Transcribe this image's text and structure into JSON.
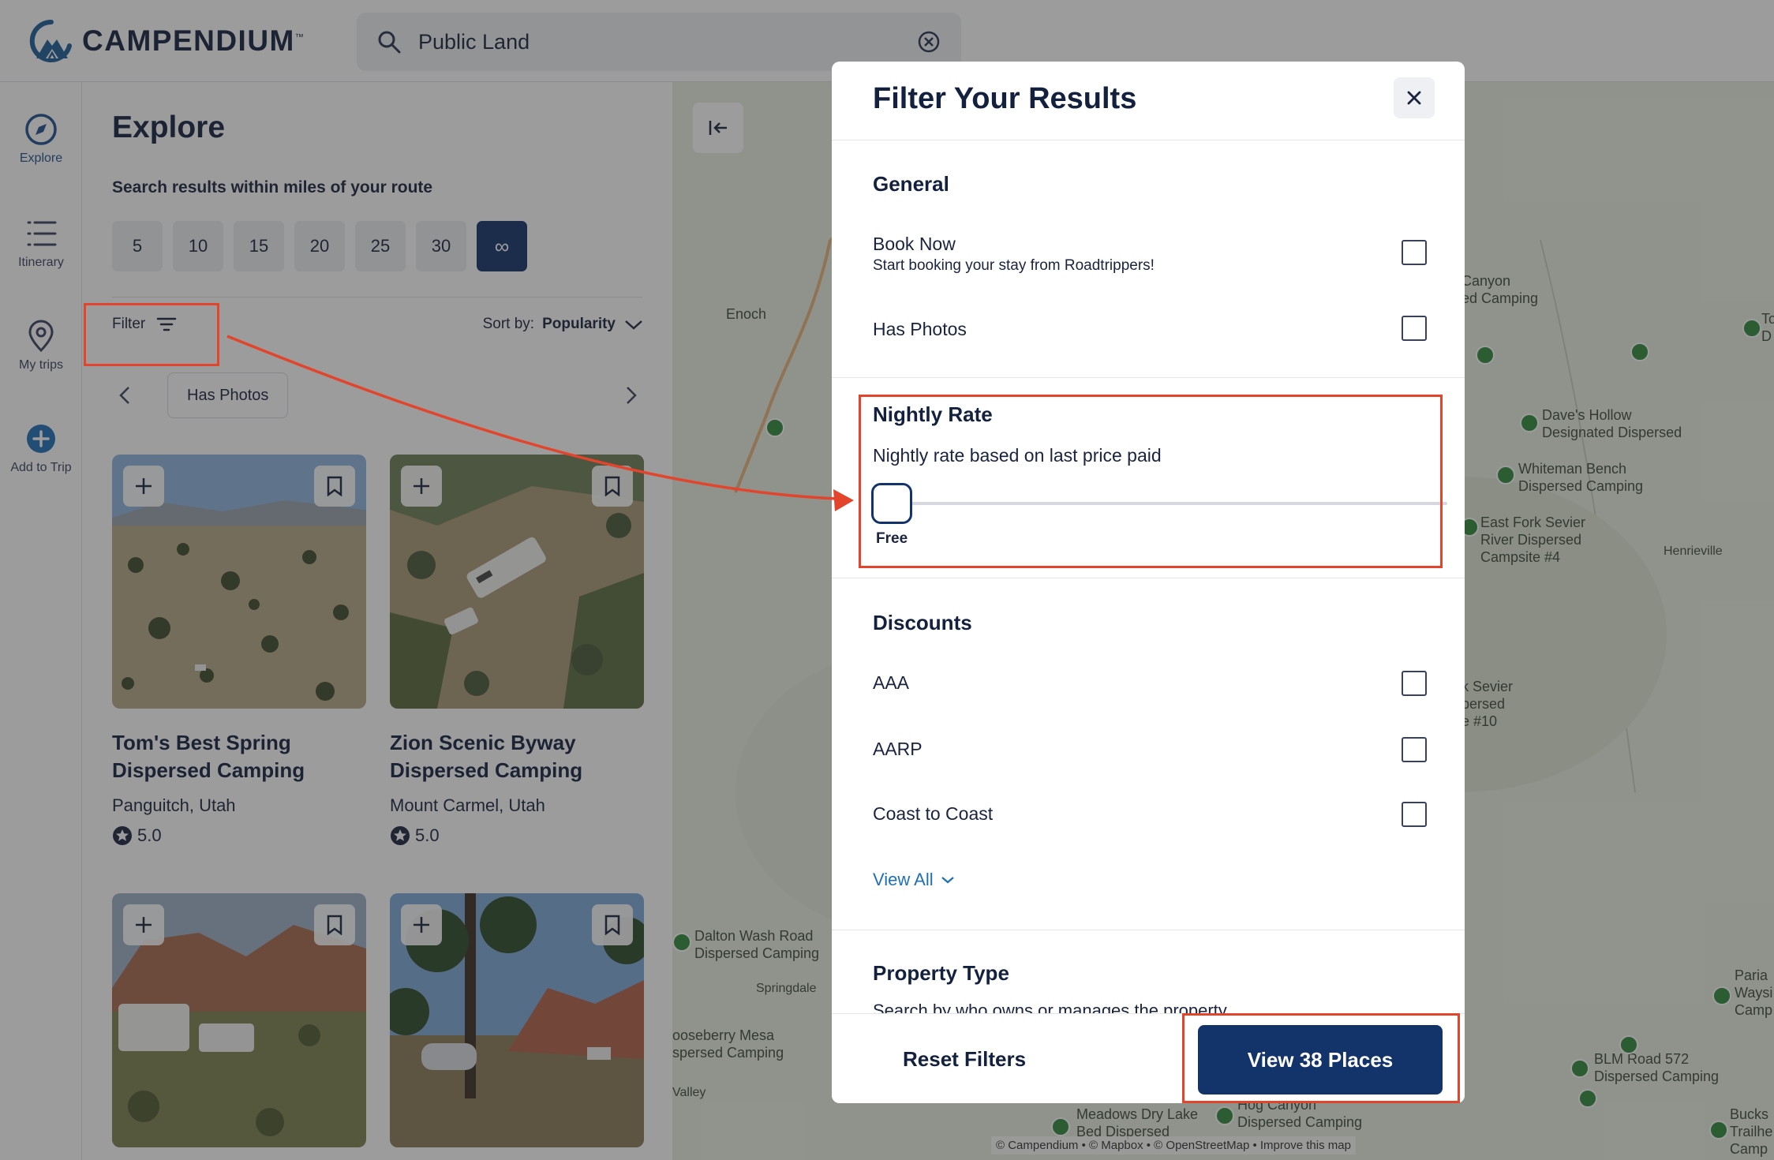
{
  "header": {
    "brand": "CAMPENDIUM",
    "brand_tm": "™",
    "search_value": "Public Land"
  },
  "nav": {
    "items": [
      {
        "label": "Explore",
        "icon": "compass-icon"
      },
      {
        "label": "Itinerary",
        "icon": "list-icon"
      },
      {
        "label": "My trips",
        "icon": "map-pin-icon"
      },
      {
        "label": "Add to Trip",
        "icon": "plus-circle-icon"
      }
    ]
  },
  "panel": {
    "title": "Explore",
    "subtitle": "Search results within miles of your route",
    "miles": [
      "5",
      "10",
      "15",
      "20",
      "25",
      "30",
      "∞"
    ],
    "selected_mile": "∞",
    "filter_label": "Filter",
    "sort_prefix": "Sort by:",
    "sort_value": "Popularity",
    "chips": [
      "Has Photos"
    ],
    "cards": [
      {
        "name": "Tom's Best Spring Dispersed Camping",
        "location": "Panguitch, Utah",
        "rating": "5.0"
      },
      {
        "name": "Zion Scenic Byway Dispersed Camping",
        "location": "Mount Carmel, Utah",
        "rating": "5.0"
      },
      {
        "name": "",
        "location": "",
        "rating": ""
      },
      {
        "name": "",
        "location": "",
        "rating": ""
      }
    ]
  },
  "map": {
    "labels": [
      "Enoch",
      "Canyon",
      "ed Camping",
      "Dave's Hollow",
      "Designated Dispersed",
      "Whiteman Bench",
      "Dispersed Camping",
      "East Fork Sevier",
      "River Dispersed",
      "Campsite #4",
      "Henrieville",
      "k Sevier",
      "persed",
      "e #10",
      "Dalton Wash Road",
      "Dispersed Camping",
      "Springdale",
      "ooseberry Mesa",
      "spersed Camping",
      "Valley",
      "Meadows Dry Lake",
      "Bed Dispersed",
      "Hog Canyon",
      "Dispersed Camping",
      "BLM Road 572",
      "Dispersed Camping",
      "Paria",
      "Waysi",
      "Camp",
      "Bucks",
      "Trailhe",
      "Camp",
      "To",
      "D"
    ],
    "attribution": "© Campendium • © Mapbox • © OpenStreetMap • Improve this map"
  },
  "modal": {
    "title": "Filter Your Results",
    "general": {
      "title": "General",
      "options": [
        {
          "label": "Book Now",
          "sub": "Start booking your stay from Roadtrippers!",
          "checked": false
        },
        {
          "label": "Has Photos",
          "sub": "",
          "checked": false
        }
      ]
    },
    "nightly": {
      "title": "Nightly Rate",
      "desc": "Nightly rate based on last price paid",
      "value_label": "Free",
      "value_fraction": 0
    },
    "discounts": {
      "title": "Discounts",
      "options": [
        {
          "label": "AAA",
          "checked": false
        },
        {
          "label": "AARP",
          "checked": false
        },
        {
          "label": "Coast to Coast",
          "checked": false
        }
      ],
      "view_all": "View All"
    },
    "property": {
      "title": "Property Type",
      "desc": "Search by who owns or manages the property"
    },
    "footer": {
      "reset": "Reset Filters",
      "view": "View 38 Places"
    }
  },
  "colors": {
    "brand_navy": "#13336b",
    "annotation_red": "#e3442c",
    "link_blue": "#1f6fb8",
    "map_pin_green": "#2f8a3c"
  }
}
